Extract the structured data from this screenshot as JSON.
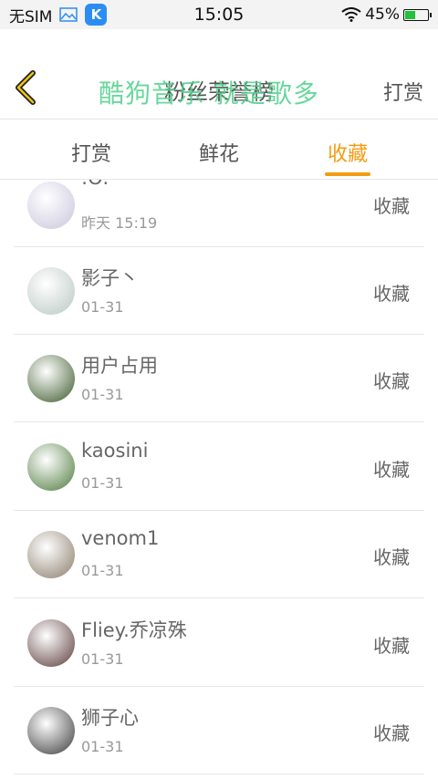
{
  "status_bar": {
    "carrier": "无SIM",
    "app_icon_letter": "K",
    "time": "15:05",
    "battery_percent": "45%",
    "battery_level": 0.45
  },
  "header": {
    "title": "粉丝荣誉榜",
    "watermark": "酷狗音乐 就是歌多",
    "action": "打赏"
  },
  "tabs": [
    {
      "label": "打赏"
    },
    {
      "label": "鲜花"
    },
    {
      "label": "收藏",
      "active": true
    }
  ],
  "rows": [
    {
      "name": ":O:",
      "date": "昨天 15:19",
      "action": "收藏",
      "avatar_color": "#c8c6dc"
    },
    {
      "name": "影子丶",
      "date": "01-31",
      "action": "收藏",
      "avatar_color": "#b9c7c3"
    },
    {
      "name": "用户占用",
      "date": "01-31",
      "action": "收藏",
      "avatar_color": "#3d5a2c"
    },
    {
      "name": "kaosini",
      "date": "01-31",
      "action": "收藏",
      "avatar_color": "#4e7a3d"
    },
    {
      "name": "venom1",
      "date": "01-31",
      "action": "收藏",
      "avatar_color": "#8a7c6a"
    },
    {
      "name": "Fliey.乔凉殊",
      "date": "01-31",
      "action": "收藏",
      "avatar_color": "#5b3a3a"
    },
    {
      "name": "狮子心",
      "date": "01-31",
      "action": "收藏",
      "avatar_color": "#3b3b3b"
    }
  ],
  "colors": {
    "accent": "#f39c12",
    "watermark": "#4ed18a",
    "battery": "#24c13b"
  }
}
